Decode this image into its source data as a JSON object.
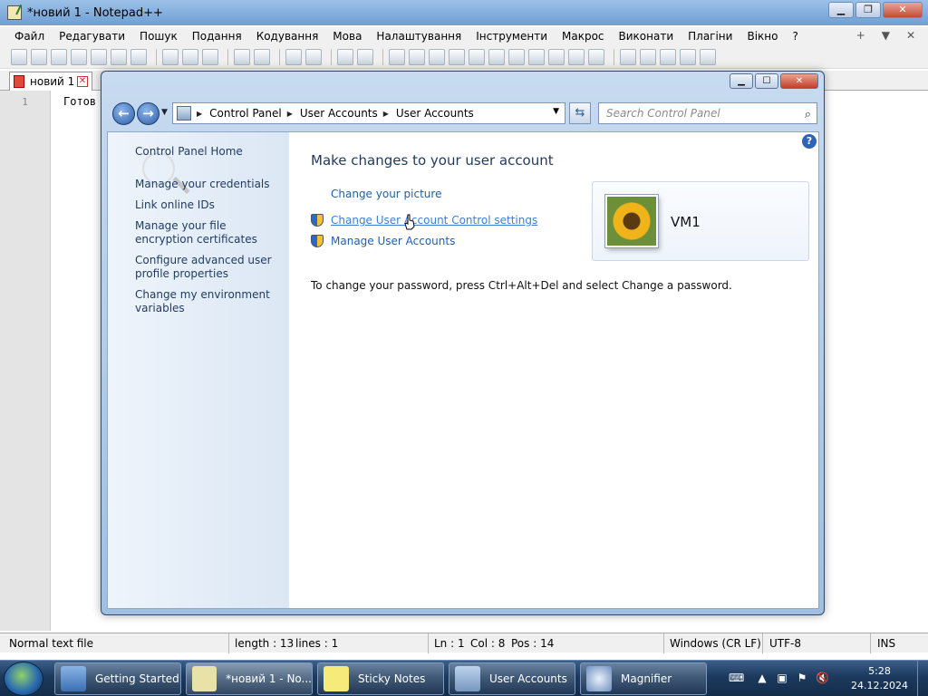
{
  "npp": {
    "title": "*новий 1 - Notepad++",
    "menu": [
      "Файл",
      "Редагувати",
      "Пошук",
      "Подання",
      "Кодування",
      "Мова",
      "Налаштування",
      "Інструменти",
      "Макрос",
      "Виконати",
      "Плагіни",
      "Вікно",
      "?"
    ],
    "menu_right": [
      "+",
      "▼",
      "✕"
    ],
    "tab_label": "новий 1",
    "line_number": "1",
    "code_text": "Готов",
    "status": {
      "file_type": "Normal text file",
      "length": "length : 13",
      "lines": "lines : 1",
      "ln": "Ln : 1",
      "col": "Col : 8",
      "pos": "Pos : 14",
      "eol": "Windows (CR LF)",
      "encoding": "UTF-8",
      "mode": "INS"
    }
  },
  "cp": {
    "breadcrumb": [
      "Control Panel",
      "User Accounts",
      "User Accounts"
    ],
    "search_placeholder": "Search Control Panel",
    "left_links": [
      "Control Panel Home",
      "Manage your credentials",
      "Link online IDs",
      "Manage your file encryption certificates",
      "Configure advanced user profile properties",
      "Change my environment variables"
    ],
    "heading": "Make changes to your user account",
    "tasks": [
      "Change your picture",
      "Change User Account Control settings",
      "Manage User Accounts"
    ],
    "password_note": "To change your password, press Ctrl+Alt+Del and select Change a password.",
    "username": "VM1",
    "help": "?"
  },
  "taskbar": {
    "buttons": [
      "Getting Started",
      "*новий 1 - No...",
      "Sticky Notes",
      "User Accounts",
      "Magnifier"
    ],
    "time": "5:28",
    "date": "24.12.2024"
  },
  "colors": {
    "link": "#1f5fb1",
    "heading": "#1e395b",
    "taskbar": "#1c3a5e"
  }
}
